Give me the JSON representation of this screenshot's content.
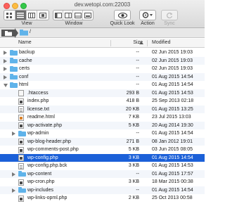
{
  "window": {
    "title": "dev.wetopi.com:22003"
  },
  "toolbar": {
    "view_label": "View",
    "window_label": "Window",
    "quicklook_label": "Quick Look",
    "action_label": "Action",
    "sync_label": "Sync"
  },
  "pathbar": {
    "current_dir": "/"
  },
  "columns": {
    "name": "Name",
    "size": "Size",
    "modified": "Modified"
  },
  "rows": [
    {
      "name": "backup",
      "type": "folder",
      "expand": "closed",
      "indent": 0,
      "size": "--",
      "modified": "02 Jun 2015 19:03"
    },
    {
      "name": "cache",
      "type": "folder",
      "expand": "closed",
      "indent": 0,
      "size": "--",
      "modified": "02 Jun 2015 19:03"
    },
    {
      "name": "certs",
      "type": "folder",
      "expand": "closed",
      "indent": 0,
      "size": "--",
      "modified": "02 Jun 2015 19:03"
    },
    {
      "name": "conf",
      "type": "folder",
      "expand": "closed",
      "indent": 0,
      "size": "--",
      "modified": "01 Aug 2015 14:54"
    },
    {
      "name": "html",
      "type": "folder",
      "expand": "open",
      "indent": 0,
      "size": "--",
      "modified": "01 Aug 2015 14:54"
    },
    {
      "name": ".htaccess",
      "type": "dot",
      "expand": "none",
      "indent": 1,
      "size": "293 B",
      "modified": "01 Aug 2015 14:53"
    },
    {
      "name": "index.php",
      "type": "php",
      "expand": "none",
      "indent": 1,
      "size": "418 B",
      "modified": "25 Sep 2013 02:18"
    },
    {
      "name": "license.txt",
      "type": "txt",
      "expand": "none",
      "indent": 1,
      "size": "20 KB",
      "modified": "01 Aug 2015 13:25"
    },
    {
      "name": "readme.html",
      "type": "html",
      "expand": "none",
      "indent": 1,
      "size": "7 KB",
      "modified": "23 Jul 2015 13:03"
    },
    {
      "name": "wp-activate.php",
      "type": "php",
      "expand": "none",
      "indent": 1,
      "size": "5 KB",
      "modified": "20 Aug 2014 19:30"
    },
    {
      "name": "wp-admin",
      "type": "folder",
      "expand": "closed",
      "indent": 1,
      "size": "--",
      "modified": "01 Aug 2015 14:54"
    },
    {
      "name": "wp-blog-header.php",
      "type": "php",
      "expand": "none",
      "indent": 1,
      "size": "271 B",
      "modified": "08 Jan 2012 19:01"
    },
    {
      "name": "wp-comments-post.php",
      "type": "php",
      "expand": "none",
      "indent": 1,
      "size": "5 KB",
      "modified": "03 Jun 2015 08:05"
    },
    {
      "name": "wp-config.php",
      "type": "php",
      "expand": "none",
      "indent": 1,
      "size": "3 KB",
      "modified": "01 Aug 2015 14:54",
      "selected": true
    },
    {
      "name": "wp-config.php.bck",
      "type": "txt",
      "expand": "none",
      "indent": 1,
      "size": "3 KB",
      "modified": "01 Aug 2015 14:53"
    },
    {
      "name": "wp-content",
      "type": "folder",
      "expand": "closed",
      "indent": 1,
      "size": "--",
      "modified": "01 Aug 2015 17:57"
    },
    {
      "name": "wp-cron.php",
      "type": "php",
      "expand": "none",
      "indent": 1,
      "size": "3 KB",
      "modified": "18 Mar 2015 00:38"
    },
    {
      "name": "wp-includes",
      "type": "folder",
      "expand": "closed",
      "indent": 1,
      "size": "--",
      "modified": "01 Aug 2015 14:54"
    },
    {
      "name": "wp-links-opml.php",
      "type": "php",
      "expand": "none",
      "indent": 1,
      "size": "2 KB",
      "modified": "25 Oct 2013 00:58"
    }
  ],
  "colors": {
    "selection": "#1b60d8",
    "folder": "#5fb3ea",
    "toolbar_top": "#eeeeee",
    "toolbar_bottom": "#d9d9d9"
  }
}
